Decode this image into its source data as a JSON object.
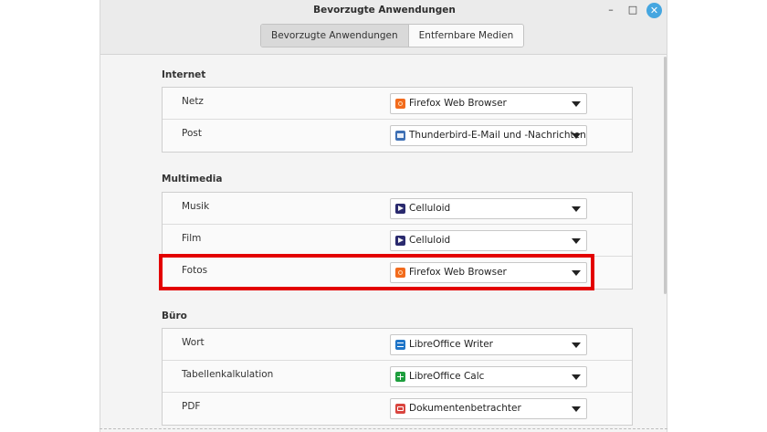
{
  "window": {
    "title": "Bevorzugte Anwendungen"
  },
  "tabs": [
    {
      "label": "Bevorzugte Anwendungen",
      "active": true
    },
    {
      "label": "Entfernbare Medien",
      "active": false
    }
  ],
  "sections": [
    {
      "title": "Internet",
      "rows": [
        {
          "label": "Netz",
          "app": "Firefox Web Browser",
          "icon": "firefox-icon"
        },
        {
          "label": "Post",
          "app": "Thunderbird-E-Mail und -Nachrichten",
          "icon": "thunderbird-icon"
        }
      ]
    },
    {
      "title": "Multimedia",
      "rows": [
        {
          "label": "Musik",
          "app": "Celluloid",
          "icon": "celluloid-icon"
        },
        {
          "label": "Film",
          "app": "Celluloid",
          "icon": "celluloid-icon"
        },
        {
          "label": "Fotos",
          "app": "Firefox Web Browser",
          "icon": "firefox-icon"
        }
      ]
    },
    {
      "title": "Büro",
      "rows": [
        {
          "label": "Wort",
          "app": "LibreOffice Writer",
          "icon": "libreoffice-writer-icon"
        },
        {
          "label": "Tabellenkalkulation",
          "app": "LibreOffice Calc",
          "icon": "libreoffice-calc-icon"
        },
        {
          "label": "PDF",
          "app": "Dokumentenbetrachter",
          "icon": "document-viewer-icon"
        }
      ]
    }
  ],
  "colors": {
    "highlight": "#e30000",
    "close_button": "#45a6e0"
  }
}
